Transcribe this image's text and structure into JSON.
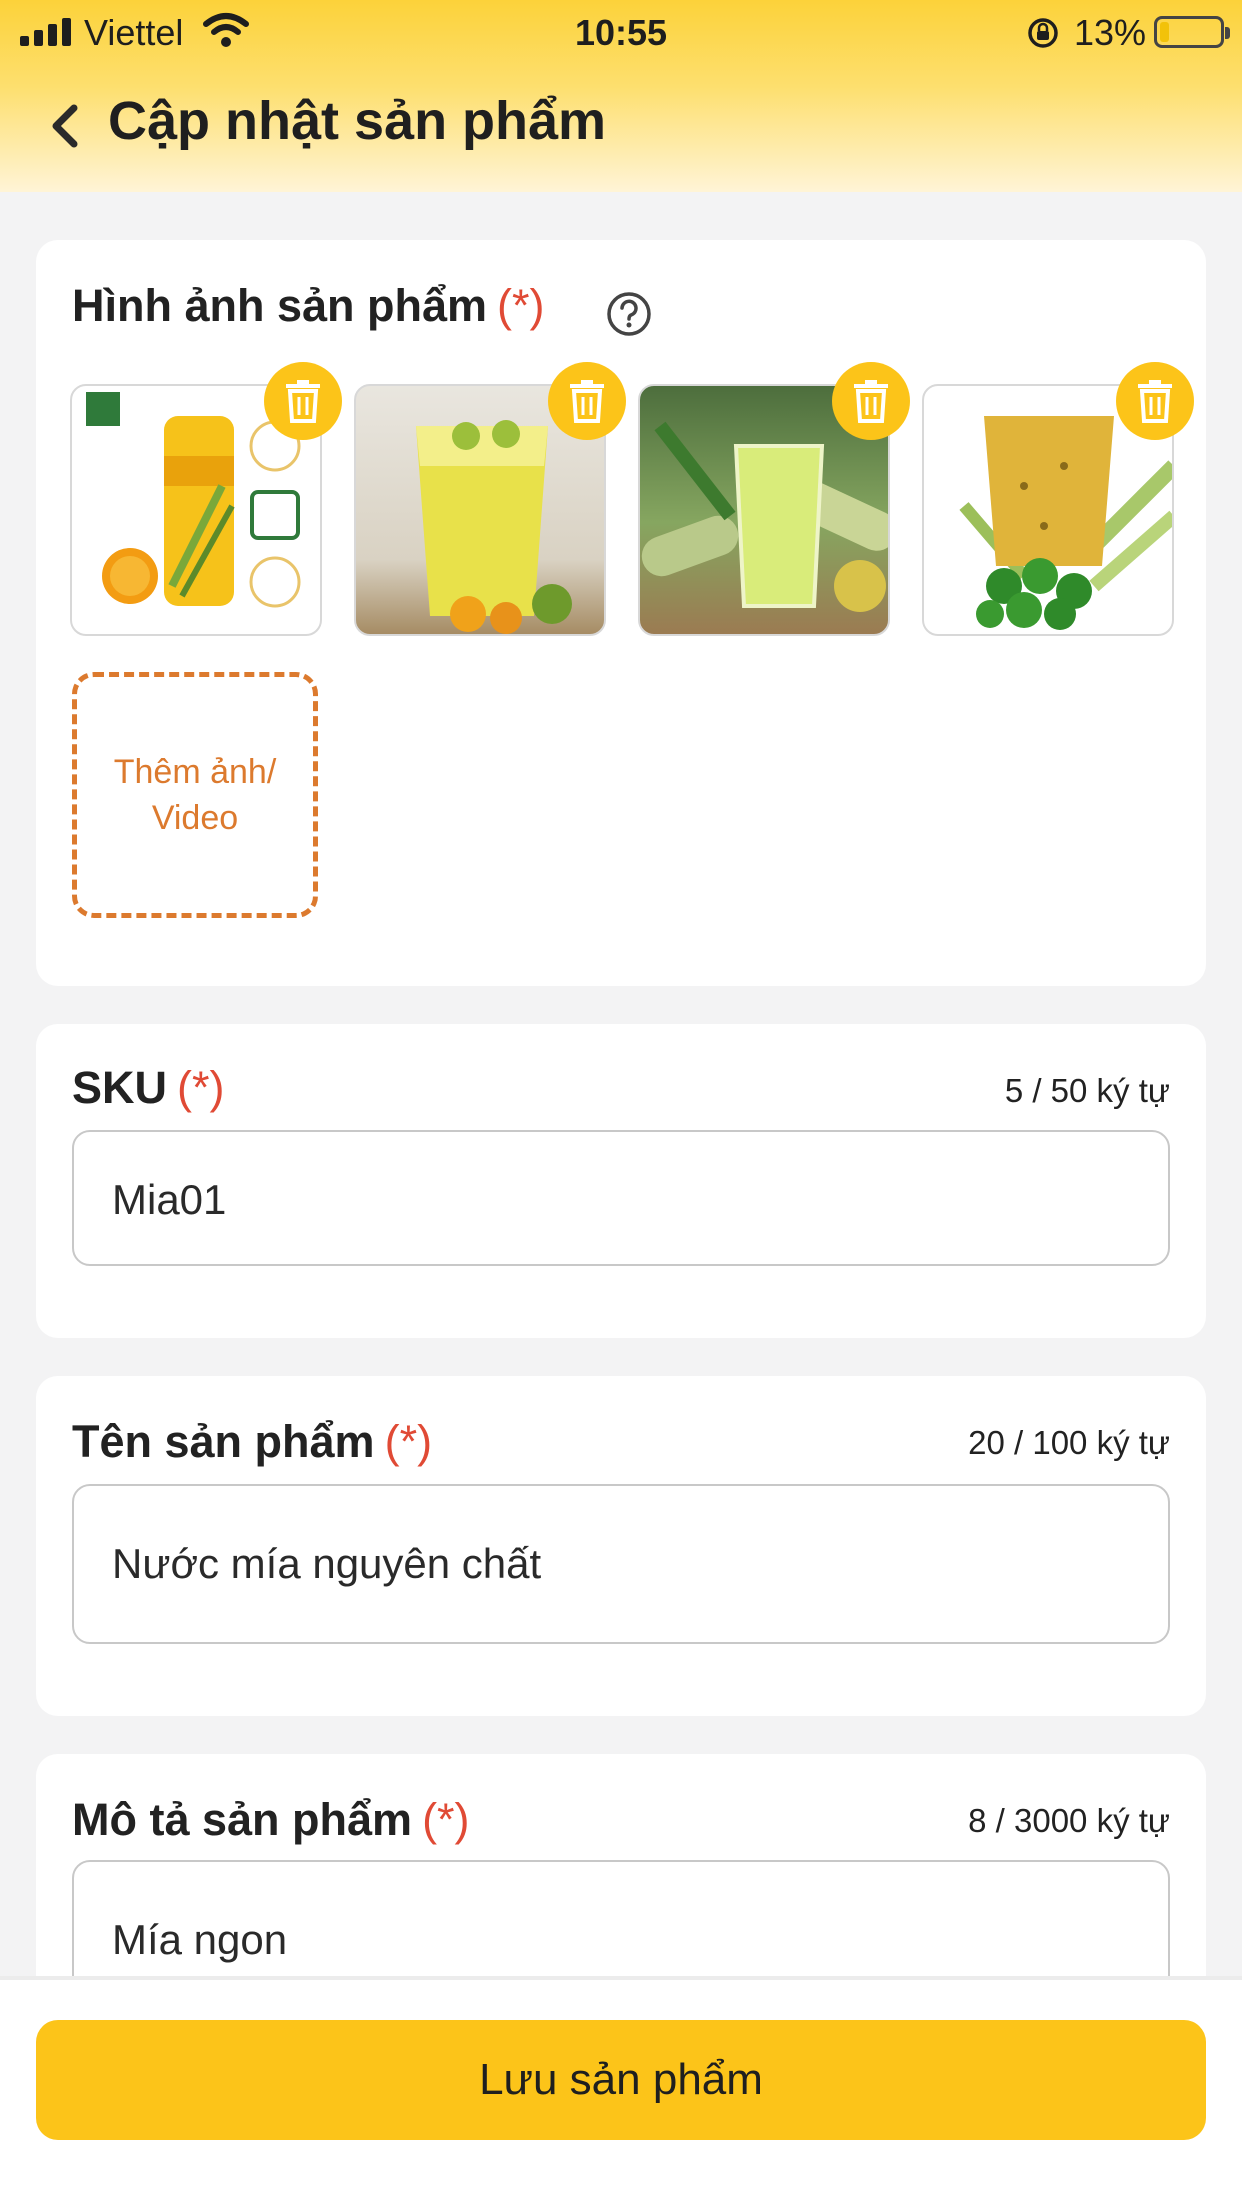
{
  "status_bar": {
    "carrier": "Viettel",
    "time": "10:55",
    "battery": "13%",
    "battery_level": 0.13
  },
  "header": {
    "title": "Cập nhật sản phẩm"
  },
  "images_section": {
    "label": "Hình ảnh sản phẩm",
    "required_mark": "(*)",
    "image_count": 4,
    "add_label": "Thêm ảnh/ Video"
  },
  "sku": {
    "label": "SKU",
    "required_mark": "(*)",
    "counter": "5 / 50 ký tự",
    "value": "Mia01"
  },
  "product_name": {
    "label": "Tên sản phẩm",
    "required_mark": "(*)",
    "counter": "20 / 100 ký tự",
    "value": "Nước mía nguyên chất"
  },
  "description": {
    "label": "Mô tả sản phẩm",
    "required_mark": "(*)",
    "counter": "8 / 3000 ký tự",
    "value": "Mía ngon"
  },
  "save_button": "Lưu sản phẩm",
  "colors": {
    "accent": "#fcc419",
    "required": "#e04a35",
    "dashed": "#dc7a2e"
  }
}
